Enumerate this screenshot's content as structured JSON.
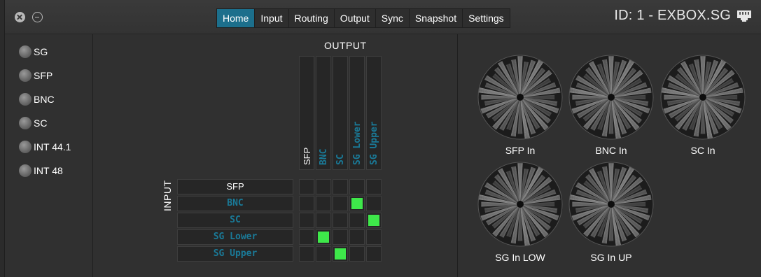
{
  "tabs": [
    {
      "label": "Home",
      "active": true
    },
    {
      "label": "Input",
      "active": false
    },
    {
      "label": "Routing",
      "active": false
    },
    {
      "label": "Output",
      "active": false
    },
    {
      "label": "Sync",
      "active": false
    },
    {
      "label": "Snapshot",
      "active": false
    },
    {
      "label": "Settings",
      "active": false
    }
  ],
  "device_id": "ID: 1 - EXBOX.SG",
  "sync_sources": [
    "SG",
    "SFP",
    "BNC",
    "SC",
    "INT 44.1",
    "INT 48"
  ],
  "matrix": {
    "output_title": "OUTPUT",
    "input_title": "INPUT",
    "outputs": [
      "SFP",
      "BNC",
      "SC",
      "SG Lower",
      "SG Upper"
    ],
    "inputs": [
      "SFP",
      "BNC",
      "SC",
      "SG Lower",
      "SG Upper"
    ],
    "routes": [
      {
        "input": "BNC",
        "output": "SG Lower"
      },
      {
        "input": "SC",
        "output": "SG Upper"
      },
      {
        "input": "SG Lower",
        "output": "BNC"
      },
      {
        "input": "SG Upper",
        "output": "SC"
      }
    ]
  },
  "meters": [
    "SFP In",
    "BNC In",
    "SC In",
    "SG In LOW",
    "SG In UP"
  ],
  "colors": {
    "accent_tab": "#1c6f8c",
    "teal_text": "#1a7a98",
    "route_active": "#3ee84a",
    "led_off": "#7a7a7a"
  },
  "icons": {
    "close": "close-icon",
    "minimize": "minimize-icon",
    "network": "ethernet-icon"
  }
}
